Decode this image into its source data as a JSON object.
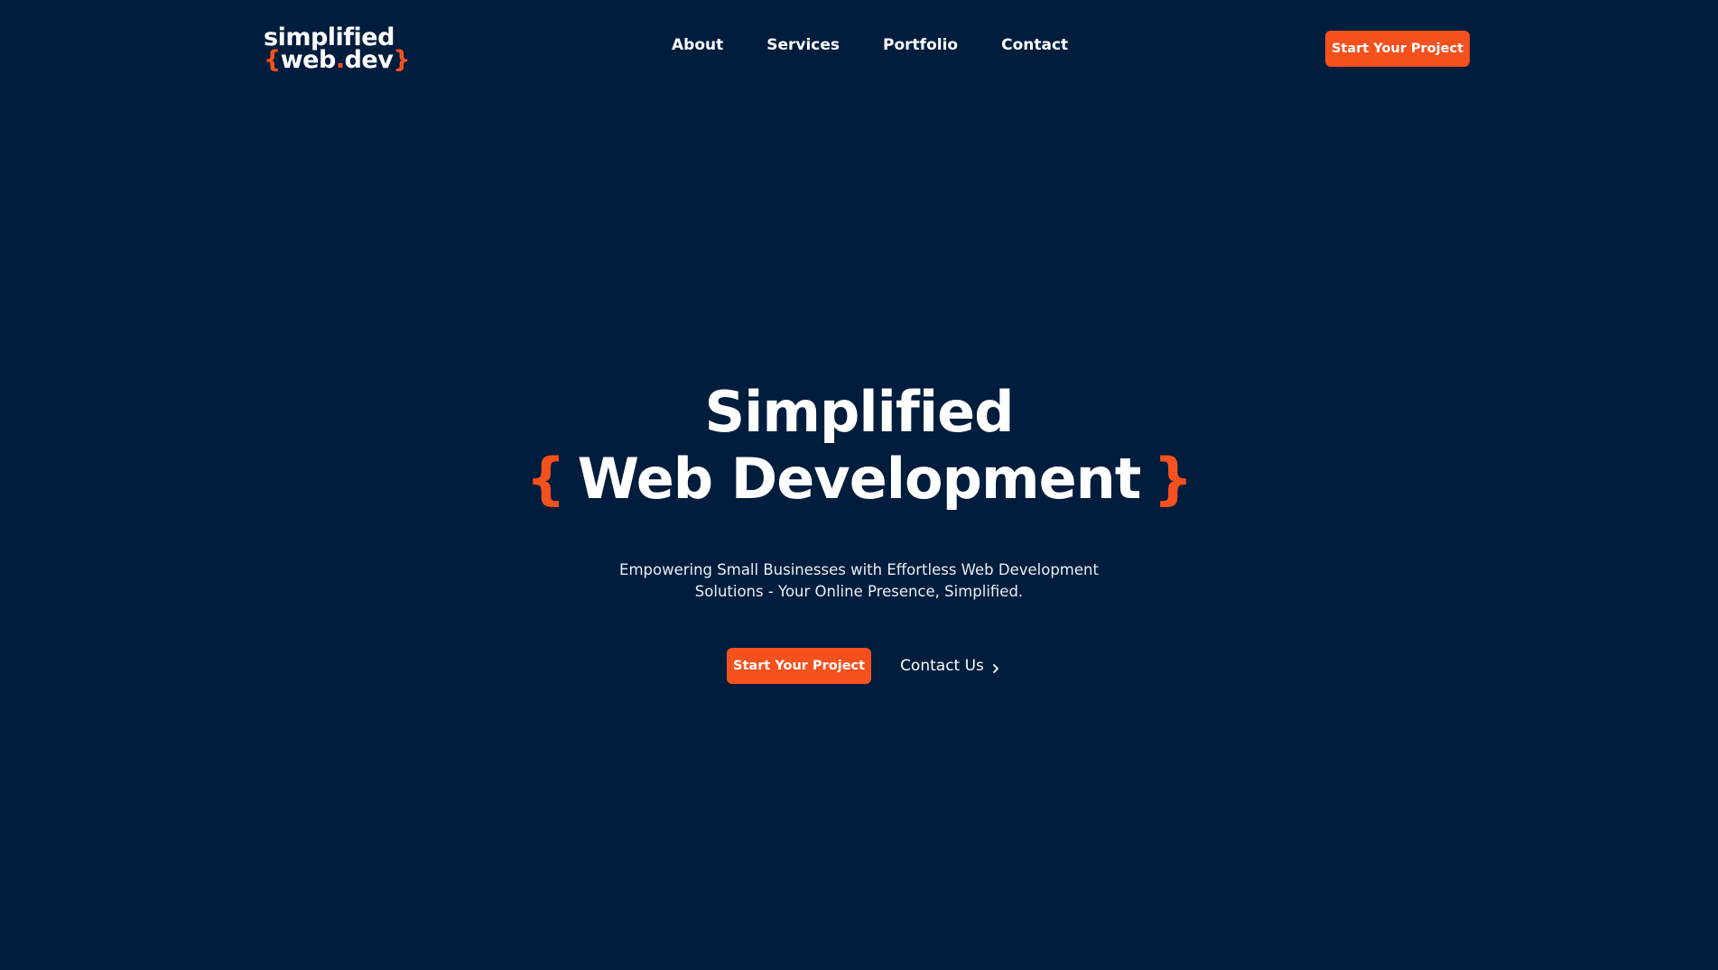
{
  "brand": {
    "logo_line1": "simplified",
    "logo_open_brace": "{",
    "logo_word": "web",
    "logo_dot": ".",
    "logo_tld": "dev",
    "logo_close_brace": "}",
    "accent_color": "#f4511e",
    "background_color": "#001d3d"
  },
  "nav": {
    "items": [
      {
        "label": "About"
      },
      {
        "label": "Services"
      },
      {
        "label": "Portfolio"
      },
      {
        "label": "Contact"
      }
    ],
    "cta_label": "Start Your Project"
  },
  "hero": {
    "title_line1": "Simplified",
    "title_open_brace": "{",
    "title_line2": "Web Development",
    "title_close_brace": "}",
    "subtitle_line1": "Empowering Small Businesses with Effortless Web Development",
    "subtitle_line2": "Solutions - Your Online Presence, Simplified.",
    "primary_cta": "Start Your Project",
    "secondary_cta": "Contact Us",
    "secondary_cta_icon": "chevron-right-icon"
  }
}
